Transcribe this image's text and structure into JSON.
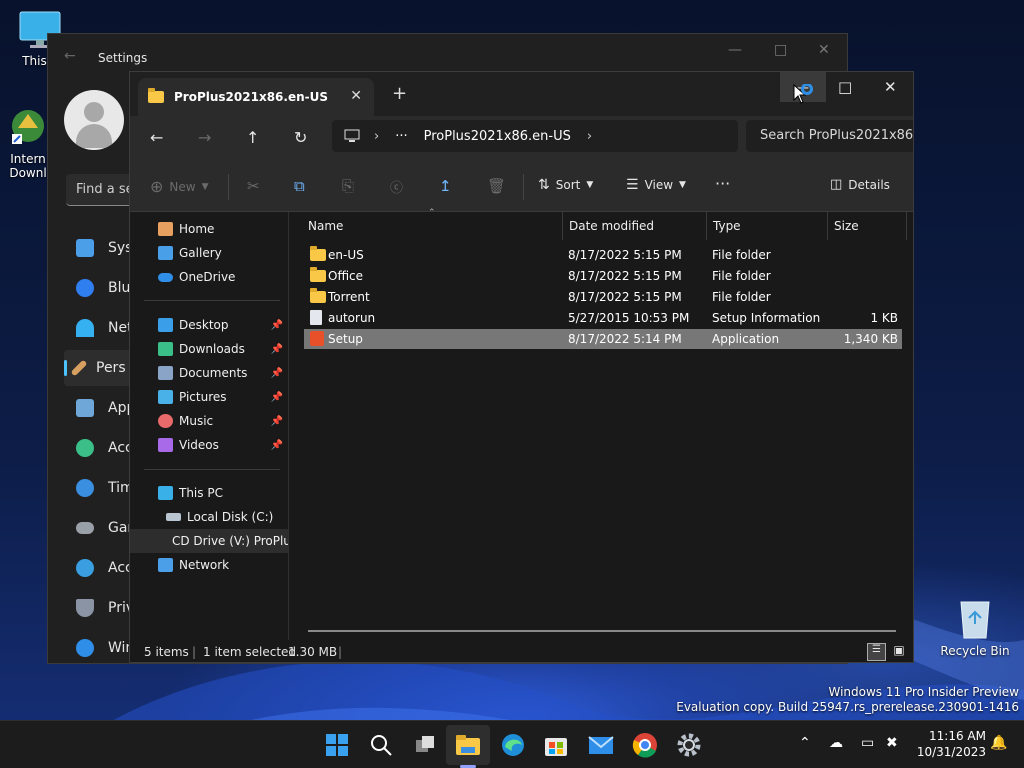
{
  "desktop": {
    "icons": [
      {
        "label": "This P",
        "icon": "monitor-icon"
      },
      {
        "label": "Intern Downl",
        "icon": "download-manager-icon"
      },
      {
        "label": "Recycle Bin",
        "icon": "recycle-bin-icon"
      }
    ],
    "watermark": {
      "line1": "Windows 11 Pro Insider Preview",
      "line2": "Evaluation copy. Build 25947.rs_prerelease.230901-1416"
    }
  },
  "settings": {
    "title": "Settings",
    "search_placeholder": "Find a se",
    "nav": [
      {
        "label": "Syst",
        "icon": "system-icon",
        "color": "#4a9fe8"
      },
      {
        "label": "Blue",
        "icon": "bluetooth-icon",
        "color": "#2f7ff0"
      },
      {
        "label": "Net",
        "icon": "network-icon",
        "color": "#35b0f0"
      },
      {
        "label": "Pers",
        "icon": "personalization-icon",
        "color": "#d8a060"
      },
      {
        "label": "App",
        "icon": "apps-icon",
        "color": "#6fa8d8"
      },
      {
        "label": "Acc",
        "icon": "accounts-icon",
        "color": "#3bbf88"
      },
      {
        "label": "Tim",
        "icon": "time-icon",
        "color": "#3a8fe0"
      },
      {
        "label": "Gar",
        "icon": "gaming-icon",
        "color": "#9aa0a8"
      },
      {
        "label": "Acc",
        "icon": "accessibility-icon",
        "color": "#3a9fe0"
      },
      {
        "label": "Priv",
        "icon": "privacy-icon",
        "color": "#8a94a4"
      },
      {
        "label": "Win",
        "icon": "windows-update-icon",
        "color": "#2f8fe8"
      }
    ]
  },
  "explorer": {
    "tab_title": "ProPlus2021x86.en-US",
    "address": {
      "current": "ProPlus2021x86.en-US",
      "overflow": "···"
    },
    "search_placeholder": "Search ProPlus2021x86.en-US",
    "commands": {
      "new": "New",
      "sort": "Sort",
      "view": "View",
      "more": "···",
      "details": "Details"
    },
    "nav_pane": {
      "quick": [
        {
          "label": "Home",
          "icon": "home-icon"
        },
        {
          "label": "Gallery",
          "icon": "gallery-icon"
        },
        {
          "label": "OneDrive",
          "icon": "onedrive-icon"
        }
      ],
      "pinned": [
        {
          "label": "Desktop",
          "icon": "desktop-folder-icon"
        },
        {
          "label": "Downloads",
          "icon": "downloads-folder-icon"
        },
        {
          "label": "Documents",
          "icon": "documents-folder-icon"
        },
        {
          "label": "Pictures",
          "icon": "pictures-folder-icon"
        },
        {
          "label": "Music",
          "icon": "music-folder-icon"
        },
        {
          "label": "Videos",
          "icon": "videos-folder-icon"
        }
      ],
      "pc": [
        {
          "label": "This PC",
          "icon": "this-pc-icon"
        },
        {
          "label": "Local Disk (C:)",
          "icon": "disk-icon"
        },
        {
          "label": "CD Drive (V:) ProPlu",
          "icon": "cd-drive-icon"
        },
        {
          "label": "Network",
          "icon": "network-icon"
        }
      ]
    },
    "columns": [
      "Name",
      "Date modified",
      "Type",
      "Size"
    ],
    "files": [
      {
        "name": "en-US",
        "date": "8/17/2022 5:15 PM",
        "type": "File folder",
        "size": "",
        "icon": "folder-icon"
      },
      {
        "name": "Office",
        "date": "8/17/2022 5:15 PM",
        "type": "File folder",
        "size": "",
        "icon": "folder-icon"
      },
      {
        "name": "Torrent",
        "date": "8/17/2022 5:15 PM",
        "type": "File folder",
        "size": "",
        "icon": "folder-icon"
      },
      {
        "name": "autorun",
        "date": "5/27/2015 10:53 PM",
        "type": "Setup Information",
        "size": "1 KB",
        "icon": "setup-info-file-icon"
      },
      {
        "name": "Setup",
        "date": "8/17/2022 5:14 PM",
        "type": "Application",
        "size": "1,340 KB",
        "icon": "office-setup-icon"
      }
    ],
    "status": {
      "items": "5 items",
      "selected": "1 item selected",
      "size": "1.30 MB"
    }
  },
  "taskbar": {
    "clock_time": "11:16 AM",
    "clock_date": "10/31/2023"
  }
}
